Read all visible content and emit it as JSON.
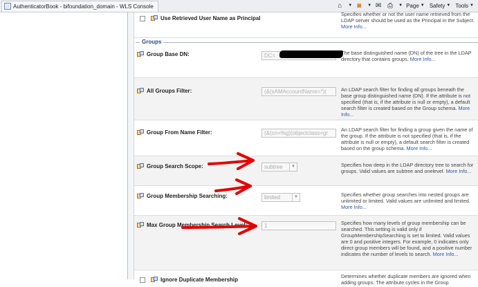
{
  "browser": {
    "tab_title": "AuthenticatorBook - bifoundation_domain - WLS Console",
    "toolbar": {
      "page_label": "Page",
      "safety_label": "Safety",
      "tools_label": "Tools"
    }
  },
  "rows": [
    {
      "label": "Use Retrieved User Name as Principal",
      "has_checkbox": true,
      "desc": "Specifies whether or not the user name retrieved from the LDAP server should be used as the Principal in the Subject.",
      "more": "More Info..."
    },
    {
      "label": "Group Base DN:",
      "value": "DC=",
      "desc": "The base distinguished name (DN) of the tree in the LDAP directory that contains groups.",
      "more": "More Info..."
    },
    {
      "label": "All Groups Filter:",
      "value": "(&(sAMAccountName=*)(",
      "desc": "An LDAP search filter for finding all groups beneath the base group distinguished name (DN). If the attribute is not specified (that is, if the attribute is null or empty), a default search filter is created based on the Group schema.",
      "more": "More Info..."
    },
    {
      "label": "Group From Name Filter:",
      "value": "(&(cn=%g)(objectclass=gr",
      "desc": "An LDAP search filter for finding a group given the name of the group. If the attribute is not specified (that is, if the attribute is null or empty), a default search filter is created based on the group schema.",
      "more": "More Info..."
    },
    {
      "label": "Group Search Scope:",
      "value": "subtree",
      "desc": "Specifies how deep in the LDAP directory tree to search for groups. Valid values are subtree and onelevel.",
      "more": "More Info..."
    },
    {
      "label": "Group Membership Searching:",
      "value": "limited",
      "desc": "Specifies whether group searches into nested groups are unlimited or limited. Valid values are unlimited and limited.",
      "more": "More Info..."
    },
    {
      "label": "Max Group Membership Search Level:",
      "value": "1",
      "desc": "Specifies how many levels of group membership can be searched. This setting is valid only if GroupMembershipSearching is set to limited. Valid values are 0 and positive integers. For example, 0 indicates only direct group members will be found, and a positive number indicates the number of levels to search.",
      "more": "More Info..."
    },
    {
      "label": "Ignore Duplicate Membership",
      "has_checkbox": true,
      "desc": "Determines whether duplicate members are ignored when adding groups. The attribute cycles in the Group"
    }
  ],
  "groups_section_title": "Groups",
  "annotation_color": "#e00000"
}
